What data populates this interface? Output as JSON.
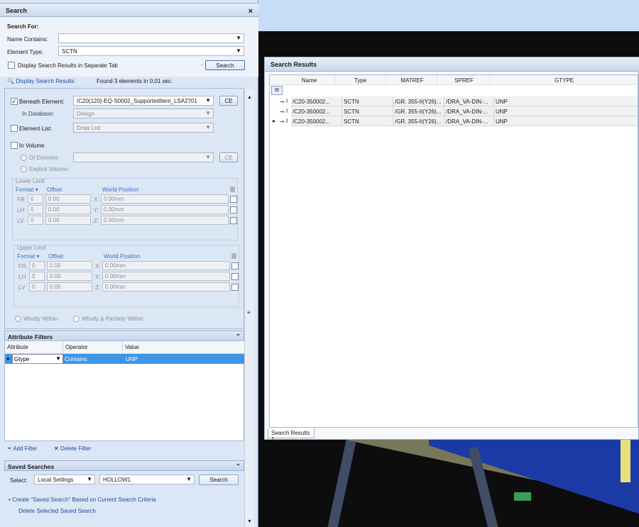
{
  "search_panel": {
    "title": "Search",
    "close": "×",
    "search_for": "Search For:",
    "name_contains_label": "Name Contains:",
    "name_contains_value": "",
    "element_type_label": "Element Type:",
    "element_type_value": "SCTN",
    "separate_tab_label": "Display Search Results in Separate Tab",
    "search_button": "Search",
    "display_results_link": "Display Search Results",
    "found_text": "Found 3 elements in 0,01 sec.",
    "dot": "·"
  },
  "criteria": {
    "beneath_label": "Beneath Element:",
    "beneath_value": "/C20(120)-EQ-S0002_SupportedItem_LSA2701",
    "ce": "CE",
    "in_database_label": "In Database:",
    "in_database_value": "Design",
    "element_list_label": "Element List:",
    "element_list_value": "Draw List",
    "in_volume_label": "In Volume",
    "of_element_label": "Of Element:",
    "explicit_volume_label": "Explicit Volume:",
    "lower_limit": "Lower Limit",
    "upper_limit": "Upper Limit",
    "format": "Format",
    "offset": "Offset",
    "world_position": "World Position",
    "rows": [
      {
        "axis": "FR",
        "n": "0",
        "off": "0.00",
        "c": "X:",
        "val": "0.00mm"
      },
      {
        "axis": "LH",
        "n": "0",
        "off": "0.00",
        "c": "Y:",
        "val": "0.00mm"
      },
      {
        "axis": "LV",
        "n": "0",
        "off": "0.00",
        "c": "Z:",
        "val": "0.00mm"
      }
    ],
    "wholly_within": "Wholly Within",
    "wholly_partially": "Wholly & Partially Within"
  },
  "attribute_filters": {
    "header": "Attribute Filters",
    "col_attribute": "Attribute",
    "col_operator": "Operator",
    "col_value": "Value",
    "row": {
      "attribute": "Gtype",
      "operator": "Contains",
      "value": "UNP"
    },
    "add_filter": "Add Filter",
    "delete_filter": "Delete Filter"
  },
  "saved_searches": {
    "header": "Saved Searches",
    "select_label": "Select:",
    "scope": "Local Settings",
    "name": "HOLLOW1",
    "search_button": "Search",
    "create_link": "Create \"Saved Search\" Based on Current Search Criteria",
    "delete_link": "Delete Selected Saved Search"
  },
  "results": {
    "title": "Search Results",
    "columns": [
      "Name",
      "Type",
      "MATREF",
      "SPREF",
      "GTYPE"
    ],
    "rows": [
      {
        "name": "/C20-350002...",
        "type": "SCTN",
        "matref": "/GR. 355-II(Y26)...",
        "spref": "/DRA_VA-DIN-...",
        "gtype": "UNP"
      },
      {
        "name": "/C20-350002...",
        "type": "SCTN",
        "matref": "/GR. 355-II(Y26)...",
        "spref": "/DRA_VA-DIN-...",
        "gtype": "UNP"
      },
      {
        "name": "/C20-350002...",
        "type": "SCTN",
        "matref": "/GR. 355-II(Y26)...",
        "spref": "/DRA_VA-DIN-...",
        "gtype": "UNP"
      }
    ],
    "tab": "Search Results 1"
  },
  "colors": {
    "accent": "#3e6fb8",
    "selected_row": "#3f95e6",
    "panel_bg": "#dbe6f6"
  }
}
